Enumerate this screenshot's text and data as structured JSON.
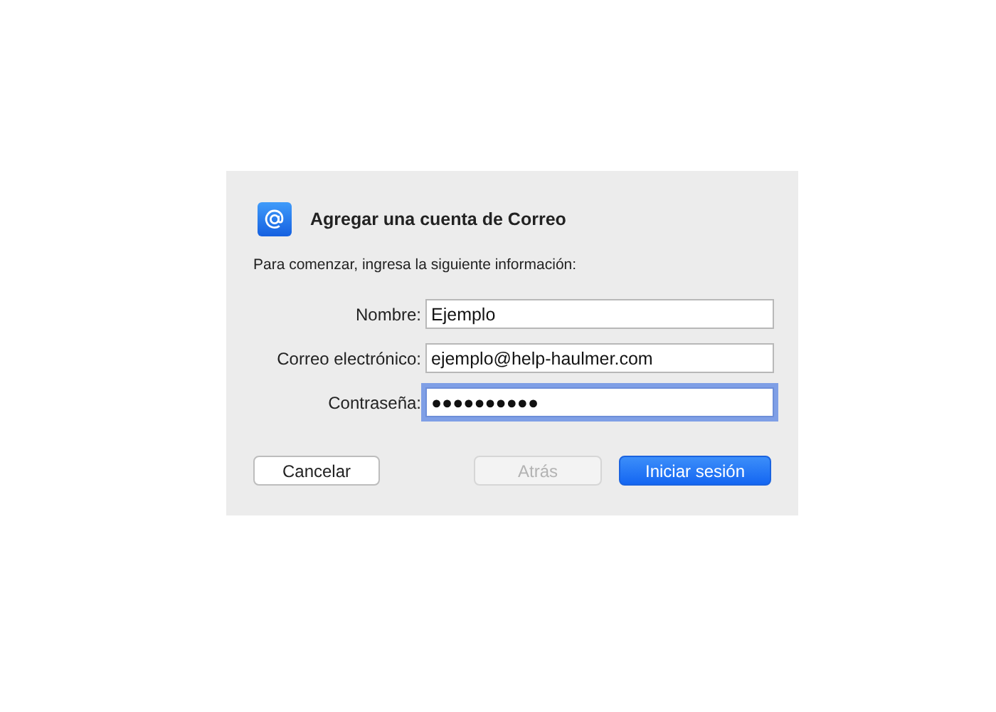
{
  "dialog": {
    "title": "Agregar una cuenta de Correo",
    "subtitle": "Para comenzar, ingresa la siguiente información:",
    "fields": [
      {
        "label": "Nombre:",
        "value": "Ejemplo",
        "focused": false
      },
      {
        "label": "Correo electrónico:",
        "value": "ejemplo@help-haulmer.com",
        "focused": false
      },
      {
        "label": "Contraseña:",
        "value": "●●●●●●●●●●",
        "focused": true
      }
    ],
    "buttons": [
      {
        "label": "Cancelar",
        "disabled": false,
        "default": false
      },
      {
        "label": "Atrás",
        "disabled": true,
        "default": false
      },
      {
        "label": "Iniciar sesión",
        "disabled": false,
        "default": true
      }
    ]
  }
}
